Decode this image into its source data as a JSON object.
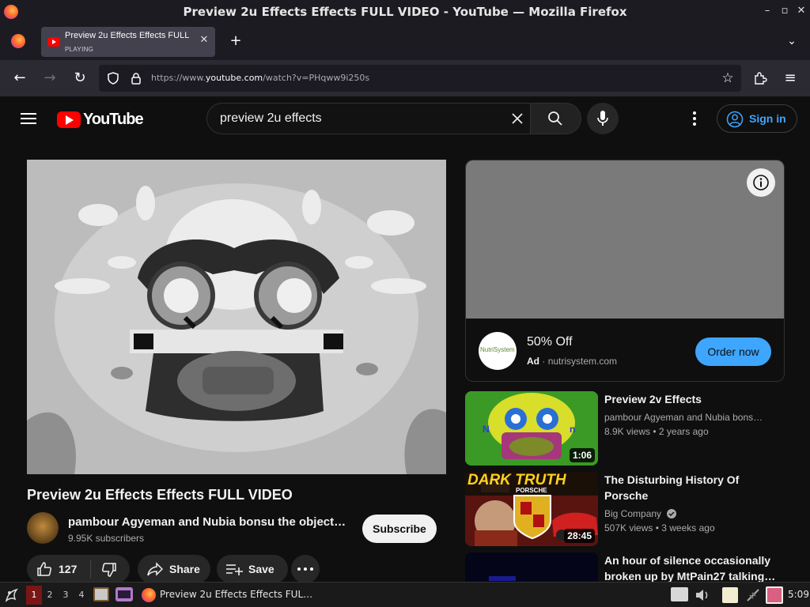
{
  "window": {
    "title": "Preview 2u Effects Effects FULL VIDEO - YouTube — Mozilla Firefox",
    "controls": [
      "–",
      "▫",
      "✕"
    ]
  },
  "tab": {
    "title": "Preview 2u Effects Effects FULL VIDEO - YouTube",
    "status": "PLAYING"
  },
  "nav": {
    "url_prefix": "https://www.",
    "url_domain": "youtube.com",
    "url_path": "/watch?v=PHqww9i250s"
  },
  "youtube": {
    "logo_text": "YouTube",
    "search_value": "preview 2u effects",
    "signin_label": "Sign in"
  },
  "video": {
    "title": "Preview 2u Effects Effects FULL VIDEO",
    "channel": "pambour Agyeman and Nubia bonsu the object…",
    "subscribers": "9.95K subscribers",
    "subscribe_label": "Subscribe",
    "likes": "127",
    "share_label": "Share",
    "save_label": "Save"
  },
  "ad": {
    "headline": "50% Off",
    "badge": "Ad",
    "dot": "·",
    "domain": "nutrisystem.com",
    "cta": "Order now",
    "logo_text": "NutriSystem"
  },
  "related": [
    {
      "title": "Preview 2v Effects",
      "channel": "pambour Agyeman and Nubia bons…",
      "views": "8.9K views",
      "age": "2 years ago",
      "duration": "1:06",
      "verified": false
    },
    {
      "title": "The Disturbing History Of Porsche",
      "channel": "Big Company",
      "views": "507K views",
      "age": "3 weeks ago",
      "duration": "28:45",
      "verified": true,
      "thumb_text": "DARK TRUTH",
      "thumb_brand": "PORSCHE"
    },
    {
      "title": "An hour of silence occasionally broken up by MtPain27 talking…",
      "channel": "",
      "views": "",
      "age": "",
      "duration": "",
      "verified": false
    }
  ],
  "taskbar": {
    "workspaces": [
      "1",
      "2",
      "3",
      "4"
    ],
    "active_workspace": "1",
    "window_label": "Preview 2u Effects Effects FUL…",
    "clock": "5:09"
  },
  "colors": {
    "accent": "#3ea6ff",
    "yt_red": "#ff0000",
    "bg": "#0f0f0f"
  }
}
